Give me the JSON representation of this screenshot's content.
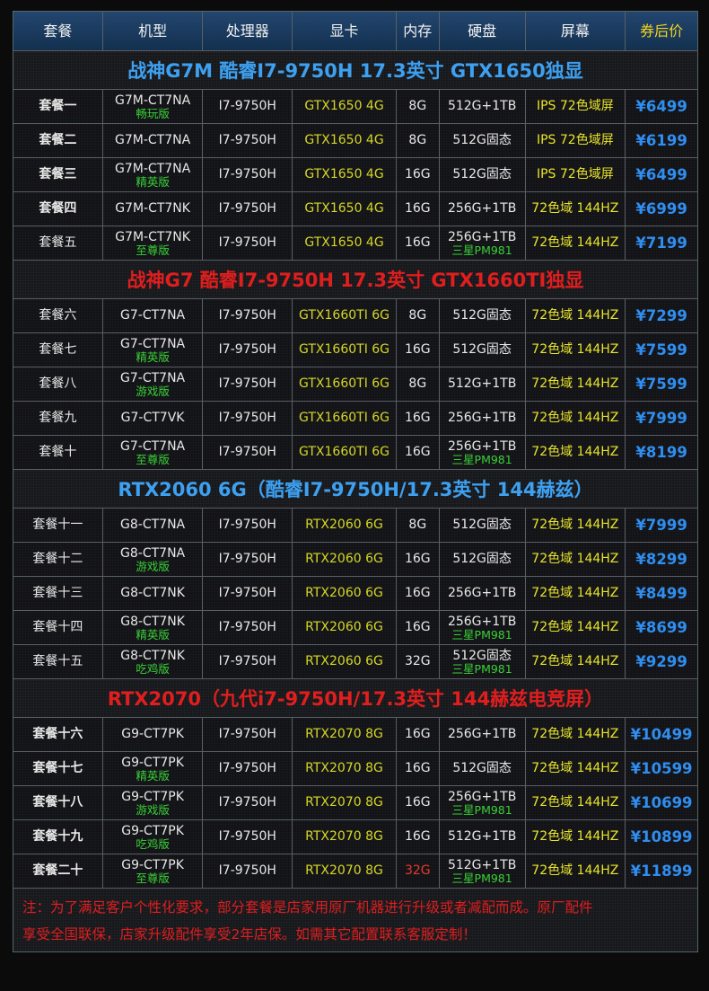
{
  "header": [
    "套餐",
    "机型",
    "处理器",
    "显卡",
    "内存",
    "硬盘",
    "屏幕",
    "券后价"
  ],
  "sections": [
    {
      "title": "战神G7M 酷睿I7-9750H 17.3英寸 GTX1650独显",
      "color": "blue",
      "rows": [
        {
          "name": "套餐一",
          "bold": true,
          "model": "G7M-CT7NA",
          "sub": "畅玩版",
          "cpu": "I7-9750H",
          "gpu": "GTX1650 4G",
          "ram": "8G",
          "disk": "512G+1TB",
          "disk_sub": "",
          "screen": "IPS 72色域屏",
          "price": "¥6499"
        },
        {
          "name": "套餐二",
          "bold": true,
          "model": "G7M-CT7NA",
          "sub": "",
          "cpu": "I7-9750H",
          "gpu": "GTX1650 4G",
          "ram": "8G",
          "disk": "512G固态",
          "disk_sub": "",
          "screen": "IPS 72色域屏",
          "price": "¥6199"
        },
        {
          "name": "套餐三",
          "bold": true,
          "model": "G7M-CT7NA",
          "sub": "精英版",
          "cpu": "I7-9750H",
          "gpu": "GTX1650 4G",
          "ram": "16G",
          "disk": "512G固态",
          "disk_sub": "",
          "screen": "IPS 72色域屏",
          "price": "¥6499"
        },
        {
          "name": "套餐四",
          "bold": true,
          "model": "G7M-CT7NK",
          "sub": "",
          "cpu": "I7-9750H",
          "gpu": "GTX1650 4G",
          "ram": "16G",
          "disk": "256G+1TB",
          "disk_sub": "",
          "screen": "72色域 144HZ",
          "price": "¥6999"
        },
        {
          "name": "套餐五",
          "bold": false,
          "model": "G7M-CT7NK",
          "sub": "至尊版",
          "cpu": "I7-9750H",
          "gpu": "GTX1650 4G",
          "ram": "16G",
          "disk": "256G+1TB",
          "disk_sub": "三星PM981",
          "screen": "72色域 144HZ",
          "price": "¥7199"
        }
      ]
    },
    {
      "title": "战神G7 酷睿I7-9750H 17.3英寸 GTX1660TI独显",
      "color": "red",
      "rows": [
        {
          "name": "套餐六",
          "bold": false,
          "model": "G7-CT7NA",
          "sub": "",
          "cpu": "I7-9750H",
          "gpu": "GTX1660TI 6G",
          "ram": "8G",
          "disk": "512G固态",
          "disk_sub": "",
          "screen": "72色域 144HZ",
          "price": "¥7299"
        },
        {
          "name": "套餐七",
          "bold": false,
          "model": "G7-CT7NA",
          "sub": "精英版",
          "cpu": "I7-9750H",
          "gpu": "GTX1660TI 6G",
          "ram": "16G",
          "disk": "512G固态",
          "disk_sub": "",
          "screen": "72色域 144HZ",
          "price": "¥7599"
        },
        {
          "name": "套餐八",
          "bold": false,
          "model": "G7-CT7NA",
          "sub": "游戏版",
          "cpu": "I7-9750H",
          "gpu": "GTX1660TI 6G",
          "ram": "8G",
          "disk": "512G+1TB",
          "disk_sub": "",
          "screen": "72色域 144HZ",
          "price": "¥7599"
        },
        {
          "name": "套餐九",
          "bold": false,
          "model": "G7-CT7VK",
          "sub": "",
          "cpu": "I7-9750H",
          "gpu": "GTX1660TI 6G",
          "ram": "16G",
          "disk": "256G+1TB",
          "disk_sub": "",
          "screen": "72色域 144HZ",
          "price": "¥7999"
        },
        {
          "name": "套餐十",
          "bold": false,
          "model": "G7-CT7NA",
          "sub": "至尊版",
          "cpu": "I7-9750H",
          "gpu": "GTX1660TI 6G",
          "ram": "16G",
          "disk": "256G+1TB",
          "disk_sub": "三星PM981",
          "screen": "72色域 144HZ",
          "price": "¥8199"
        }
      ]
    },
    {
      "title": "RTX2060 6G（酷睿I7-9750H/17.3英寸 144赫兹）",
      "color": "blue",
      "rows": [
        {
          "name": "套餐十一",
          "bold": false,
          "model": "G8-CT7NA",
          "sub": "",
          "cpu": "I7-9750H",
          "gpu": "RTX2060 6G",
          "ram": "8G",
          "disk": "512G固态",
          "disk_sub": "",
          "screen": "72色域 144HZ",
          "price": "¥7999"
        },
        {
          "name": "套餐十二",
          "bold": false,
          "model": "G8-CT7NA",
          "sub": "游戏版",
          "cpu": "I7-9750H",
          "gpu": "RTX2060 6G",
          "ram": "16G",
          "disk": "512G固态",
          "disk_sub": "",
          "screen": "72色域 144HZ",
          "price": "¥8299"
        },
        {
          "name": "套餐十三",
          "bold": false,
          "model": "G8-CT7NK",
          "sub": "",
          "cpu": "I7-9750H",
          "gpu": "RTX2060 6G",
          "ram": "16G",
          "disk": "256G+1TB",
          "disk_sub": "",
          "screen": "72色域 144HZ",
          "price": "¥8499"
        },
        {
          "name": "套餐十四",
          "bold": false,
          "model": "G8-CT7NK",
          "sub": "精英版",
          "cpu": "I7-9750H",
          "gpu": "RTX2060 6G",
          "ram": "16G",
          "disk": "256G+1TB",
          "disk_sub": "三星PM981",
          "screen": "72色域 144HZ",
          "price": "¥8699"
        },
        {
          "name": "套餐十五",
          "bold": false,
          "model": "G8-CT7NK",
          "sub": "吃鸡版",
          "cpu": "I7-9750H",
          "gpu": "RTX2060 6G",
          "ram": "32G",
          "disk": "512G固态",
          "disk_sub": "三星PM981",
          "screen": "72色域 144HZ",
          "price": "¥9299"
        }
      ]
    },
    {
      "title": "RTX2070（九代i7-9750H/17.3英寸 144赫兹电竞屏）",
      "color": "red",
      "rows": [
        {
          "name": "套餐十六",
          "bold": true,
          "model": "G9-CT7PK",
          "sub": "",
          "cpu": "I7-9750H",
          "gpu": "RTX2070 8G",
          "ram": "16G",
          "disk": "256G+1TB",
          "disk_sub": "",
          "screen": "72色域 144HZ",
          "price": "¥10499"
        },
        {
          "name": "套餐十七",
          "bold": true,
          "model": "G9-CT7PK",
          "sub": "精英版",
          "cpu": "I7-9750H",
          "gpu": "RTX2070 8G",
          "ram": "16G",
          "disk": "512G固态",
          "disk_sub": "",
          "screen": "72色域 144HZ",
          "price": "¥10599"
        },
        {
          "name": "套餐十八",
          "bold": true,
          "model": "G9-CT7PK",
          "sub": "游戏版",
          "cpu": "I7-9750H",
          "gpu": "RTX2070 8G",
          "ram": "16G",
          "disk": "256G+1TB",
          "disk_sub": "三星PM981",
          "screen": "72色域 144HZ",
          "price": "¥10699"
        },
        {
          "name": "套餐十九",
          "bold": true,
          "model": "G9-CT7PK",
          "sub": "吃鸡版",
          "cpu": "I7-9750H",
          "gpu": "RTX2070 8G",
          "ram": "16G",
          "disk": "512G+1TB",
          "disk_sub": "",
          "screen": "72色域 144HZ",
          "price": "¥10899"
        },
        {
          "name": "套餐二十",
          "bold": true,
          "model": "G9-CT7PK",
          "sub": "至尊版",
          "cpu": "I7-9750H",
          "gpu": "RTX2070 8G",
          "ram": "32G",
          "ram_red": true,
          "disk": "512G+1TB",
          "disk_sub": "三星PM981",
          "screen": "72色域 144HZ",
          "price": "¥11899"
        }
      ]
    }
  ],
  "note": {
    "line1": "注：为了满足客户个性化要求，部分套餐是店家用原厂机器进行升级或者减配而成。原厂配件",
    "line2": "享受全国联保，店家升级配件享受2年店保。如需其它配置联系客服定制！"
  },
  "colors": {
    "header_bg": "#1a3a5e",
    "price": "#2f8ef0",
    "gpu": "#d6d626",
    "sub": "#39d137",
    "red": "#e01e1e",
    "blue": "#3da0f0"
  }
}
